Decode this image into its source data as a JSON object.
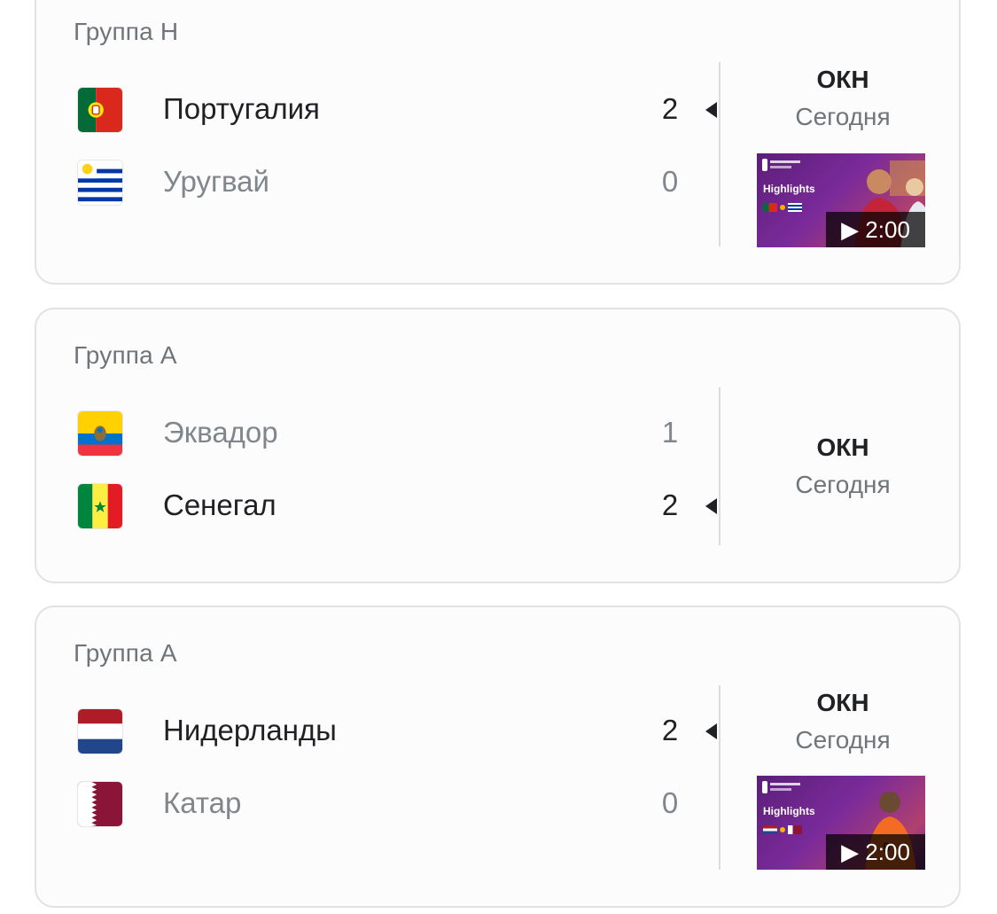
{
  "matches": [
    {
      "group": "Группа H",
      "teams": [
        {
          "name": "Португалия",
          "score": "2",
          "winner": true,
          "flag": "portugal-flag"
        },
        {
          "name": "Уругвай",
          "score": "0",
          "winner": false,
          "flag": "uruguay-flag"
        }
      ],
      "status": "ОКН",
      "date": "Сегодня",
      "highlight": {
        "label": "Highlights",
        "duration": "▶ 2:00"
      }
    },
    {
      "group": "Группа A",
      "teams": [
        {
          "name": "Эквадор",
          "score": "1",
          "winner": false,
          "flag": "ecuador-flag"
        },
        {
          "name": "Сенегал",
          "score": "2",
          "winner": true,
          "flag": "senegal-flag"
        }
      ],
      "status": "ОКН",
      "date": "Сегодня"
    },
    {
      "group": "Группа A",
      "teams": [
        {
          "name": "Нидерланды",
          "score": "2",
          "winner": true,
          "flag": "netherlands-flag"
        },
        {
          "name": "Катар",
          "score": "0",
          "winner": false,
          "flag": "qatar-flag"
        }
      ],
      "status": "ОКН",
      "date": "Сегодня",
      "highlight": {
        "label": "Highlights",
        "duration": "▶ 2:00"
      }
    }
  ],
  "colors": {
    "winner_text": "#202124",
    "loser_text": "#80868b",
    "thumb_purple": "#6d2c8f"
  }
}
